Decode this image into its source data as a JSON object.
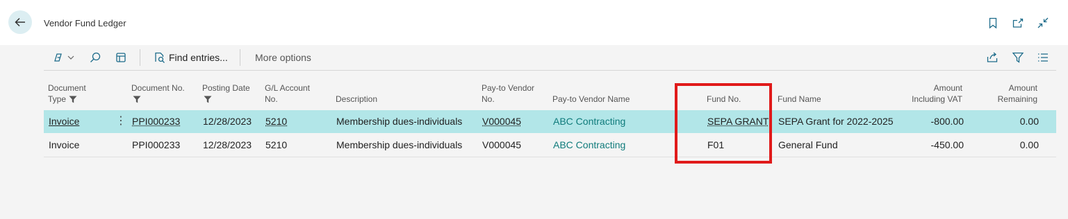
{
  "header": {
    "title": "Vendor Fund Ledger",
    "icons": [
      "back-arrow-icon",
      "bookmark-icon",
      "open-new-window-icon",
      "collapse-icon"
    ]
  },
  "toolbar": {
    "find_entries_label": "Find entries...",
    "more_options_label": "More options",
    "icons": [
      "copilot-icon",
      "chevron-down-icon",
      "search-icon",
      "edit-list-icon",
      "find-entries-icon",
      "share-icon",
      "filter-icon",
      "list-view-icon"
    ]
  },
  "columns": {
    "document_type": [
      "Document",
      "Type"
    ],
    "document_no": "Document No.",
    "posting_date": "Posting Date",
    "gl_account_no": [
      "G/L Account",
      "No."
    ],
    "description": "Description",
    "pay_to_vendor_no": [
      "Pay-to Vendor",
      "No."
    ],
    "pay_to_vendor_name": "Pay-to Vendor Name",
    "fund_no": "Fund No.",
    "fund_name": "Fund Name",
    "amount_incl_vat": [
      "Amount",
      "Including VAT"
    ],
    "amount_remaining": [
      "Amount",
      "Remaining"
    ]
  },
  "rows": [
    {
      "document_type": "Invoice",
      "document_no": "PPI000233",
      "posting_date": "12/28/2023",
      "gl_account_no": "5210",
      "description": "Membership dues-individuals",
      "pay_to_vendor_no": "V000045",
      "pay_to_vendor_name": "ABC Contracting",
      "fund_no": "SEPA GRANT",
      "fund_name": "SEPA Grant for 2022-2025",
      "amount_incl_vat": "-800.00",
      "amount_remaining": "0.00",
      "selected": true
    },
    {
      "document_type": "Invoice",
      "document_no": "PPI000233",
      "posting_date": "12/28/2023",
      "gl_account_no": "5210",
      "description": "Membership dues-individuals",
      "pay_to_vendor_no": "V000045",
      "pay_to_vendor_name": "ABC Contracting",
      "fund_no": "F01",
      "fund_name": "General Fund",
      "amount_incl_vat": "-450.00",
      "amount_remaining": "0.00",
      "selected": false
    }
  ],
  "colors": {
    "selected_row": "#b2e6e8",
    "link": "#0f7b7b",
    "highlight_box": "#e01a1a"
  }
}
